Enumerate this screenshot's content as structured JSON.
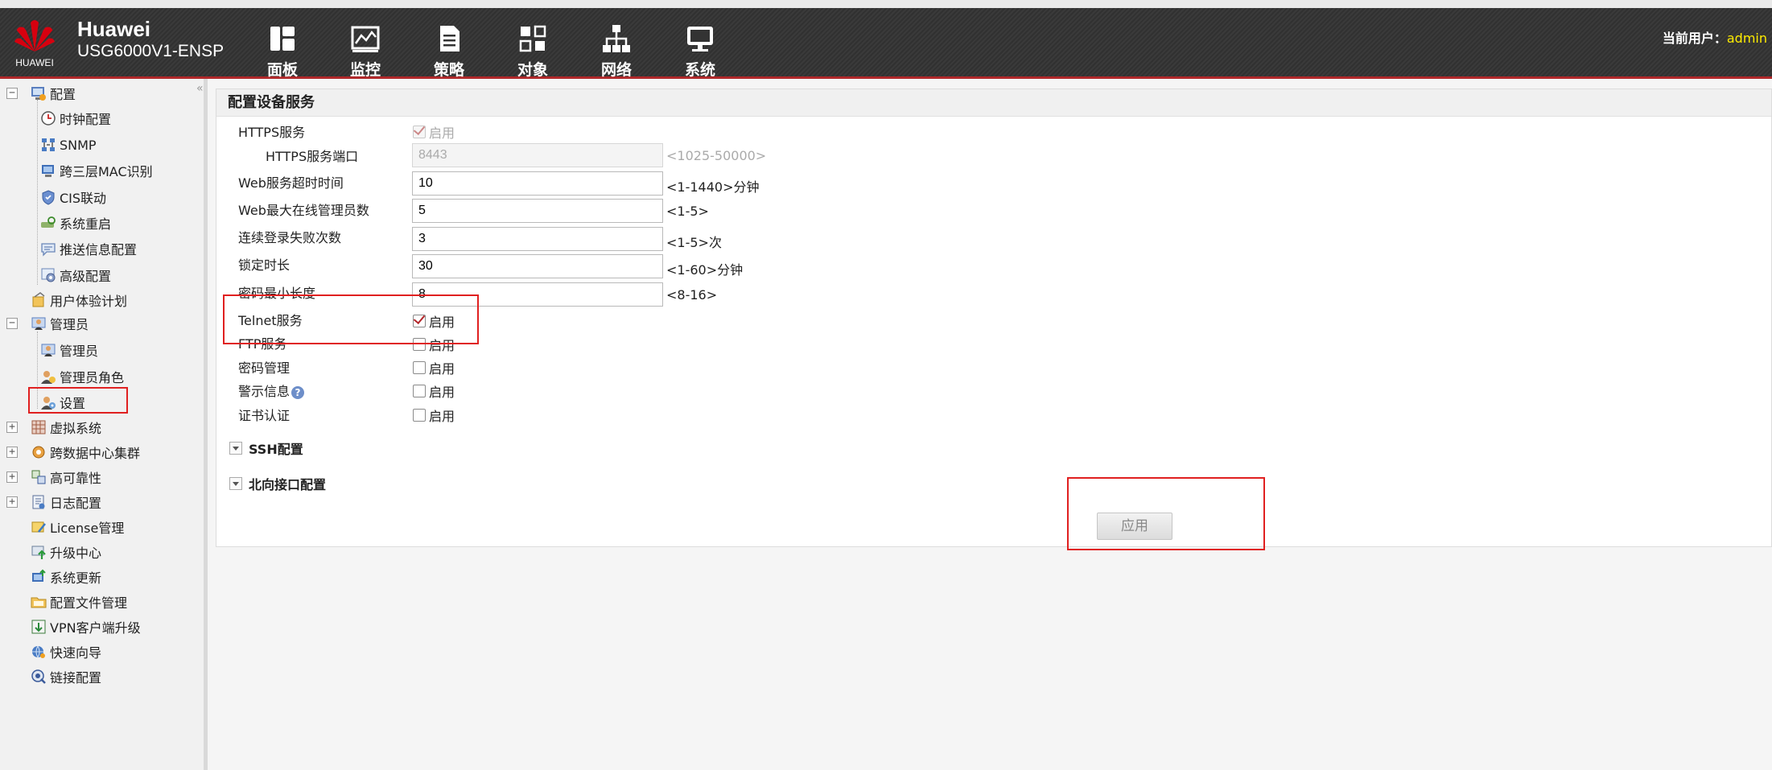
{
  "header": {
    "logo_text": "HUAWEI",
    "brand_title": "Huawei",
    "brand_model": "USG6000V1-ENSP",
    "nav": [
      {
        "label": "面板",
        "icon": "dashboard-icon"
      },
      {
        "label": "监控",
        "icon": "monitor-chart-icon"
      },
      {
        "label": "策略",
        "icon": "policy-document-icon"
      },
      {
        "label": "对象",
        "icon": "object-icon"
      },
      {
        "label": "网络",
        "icon": "network-icon"
      },
      {
        "label": "系统",
        "icon": "system-monitor-icon"
      }
    ],
    "user_label": "当前用户：",
    "user_name": "admin"
  },
  "sidebar": {
    "collapse_glyph": "«",
    "config": {
      "label": "配置",
      "children": [
        "时钟配置",
        "SNMP",
        "跨三层MAC识别",
        "CIS联动",
        "系统重启",
        "推送信息配置",
        "高级配置"
      ]
    },
    "ux_plan": "用户体验计划",
    "admin": {
      "label": "管理员",
      "children": [
        "管理员",
        "管理员角色",
        "设置"
      ]
    },
    "others": [
      "虚拟系统",
      "跨数据中心集群",
      "高可靠性",
      "日志配置",
      "License管理",
      "升级中心",
      "系统更新",
      "配置文件管理",
      "VPN客户端升级",
      "快速向导",
      "链接配置"
    ]
  },
  "panel": {
    "title": "配置设备服务",
    "enable_text": "启用",
    "https_label": "HTTPS服务",
    "https_port_label": "HTTPS服务端口",
    "https_port_value": "8443",
    "https_port_hint": "<1025-50000>",
    "web_timeout_label": "Web服务超时时间",
    "web_timeout_value": "10",
    "web_timeout_hint": "<1-1440>分钟",
    "web_max_admins_label": "Web最大在线管理员数",
    "web_max_admins_value": "5",
    "web_max_admins_hint": "<1-5>",
    "login_fail_label": "连续登录失败次数",
    "login_fail_value": "3",
    "login_fail_hint": "<1-5>次",
    "lock_time_label": "锁定时长",
    "lock_time_value": "30",
    "lock_time_hint": "<1-60>分钟",
    "pwd_min_len_label": "密码最小长度",
    "pwd_min_len_value": "8",
    "pwd_min_len_hint": "<8-16>",
    "telnet_label": "Telnet服务",
    "ftp_label": "FTP服务",
    "pwd_mgmt_label": "密码管理",
    "warning_label": "警示信息",
    "cert_label": "证书认证",
    "ssh_section": "SSH配置",
    "north_section": "北向接口配置",
    "apply_label": "应用",
    "checks": {
      "https": true,
      "telnet": true,
      "ftp": false,
      "pwd_mgmt": false,
      "warning": false,
      "cert": false
    }
  }
}
